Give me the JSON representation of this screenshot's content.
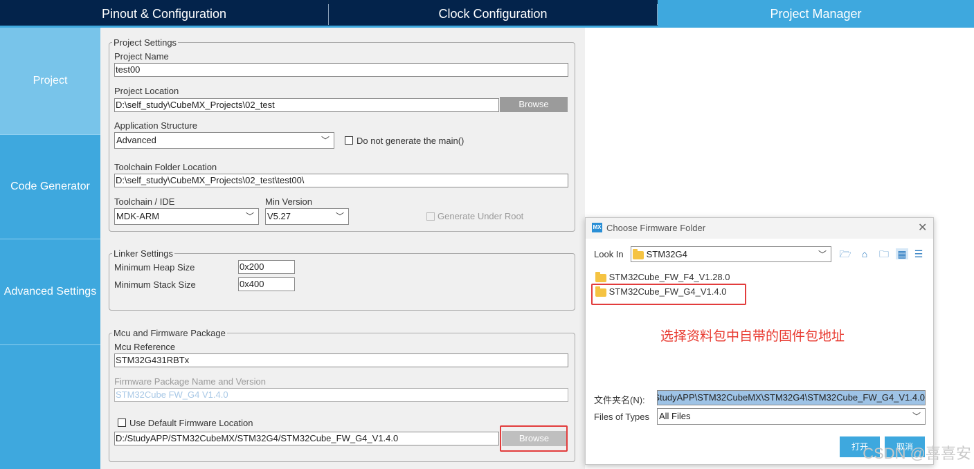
{
  "tabs": [
    {
      "label": "Pinout & Configuration"
    },
    {
      "label": "Clock Configuration"
    },
    {
      "label": "Project Manager"
    }
  ],
  "sidebar": {
    "items": [
      {
        "label": "Project"
      },
      {
        "label": "Code Generator"
      },
      {
        "label": "Advanced Settings"
      }
    ]
  },
  "project_settings": {
    "legend": "Project Settings",
    "name_label": "Project Name",
    "name_value": "test00",
    "location_label": "Project Location",
    "location_value": "D:\\self_study\\CubeMX_Projects\\02_test",
    "browse_label": "Browse",
    "structure_label": "Application Structure",
    "structure_value": "Advanced",
    "no_main_label": "Do not generate the main()",
    "toolchain_folder_label": "Toolchain Folder Location",
    "toolchain_folder_value": "D:\\self_study\\CubeMX_Projects\\02_test\\test00\\",
    "toolchain_label": "Toolchain / IDE",
    "toolchain_value": "MDK-ARM",
    "min_version_label": "Min Version",
    "min_version_value": "V5.27",
    "generate_root_label": "Generate Under Root"
  },
  "linker_settings": {
    "legend": "Linker Settings",
    "heap_label": "Minimum Heap Size",
    "heap_value": "0x200",
    "stack_label": "Minimum Stack Size",
    "stack_value": "0x400"
  },
  "mcu_firmware": {
    "legend": "Mcu and Firmware Package",
    "mcu_ref_label": "Mcu Reference",
    "mcu_ref_value": "STM32G431RBTx",
    "fw_name_label": "Firmware Package Name and Version",
    "fw_name_value": "STM32Cube FW_G4 V1.4.0",
    "default_location_label": "Use Default Firmware Location",
    "fw_location_value": "D:/StudyAPP/STM32CubeMX/STM32G4/STM32Cube_FW_G4_V1.4.0",
    "browse_label": "Browse"
  },
  "dialog": {
    "logo": "MX",
    "title": "Choose Firmware Folder",
    "look_in_label": "Look In",
    "look_in_value": "STM32G4",
    "files": [
      {
        "name": "STM32Cube_FW_F4_V1.28.0"
      },
      {
        "name": "STM32Cube_FW_G4_V1.4.0"
      }
    ],
    "annotation": "选择资料包中自带的固件包地址",
    "folder_name_label": "文件夹名(N):",
    "folder_name_value": "StudyAPP\\STM32CubeMX\\STM32G4\\STM32Cube_FW_G4_V1.4.0",
    "file_types_label": "Files of Types",
    "file_types_value": "All Files",
    "ok_label": "打开",
    "cancel_label": "取消"
  },
  "watermark": "CSDN @喜喜安",
  "colors": {
    "tab_dark": "#03234b",
    "accent": "#3ea8de",
    "nav_active": "#78c4ea",
    "highlight_red": "#e23c3c",
    "annotation_red": "#e8392f"
  },
  "icons": [
    "close-icon",
    "folder-icon",
    "chevron-down-icon",
    "home-icon",
    "new-folder-icon",
    "list-view-icon",
    "details-view-icon",
    "up-folder-icon"
  ]
}
